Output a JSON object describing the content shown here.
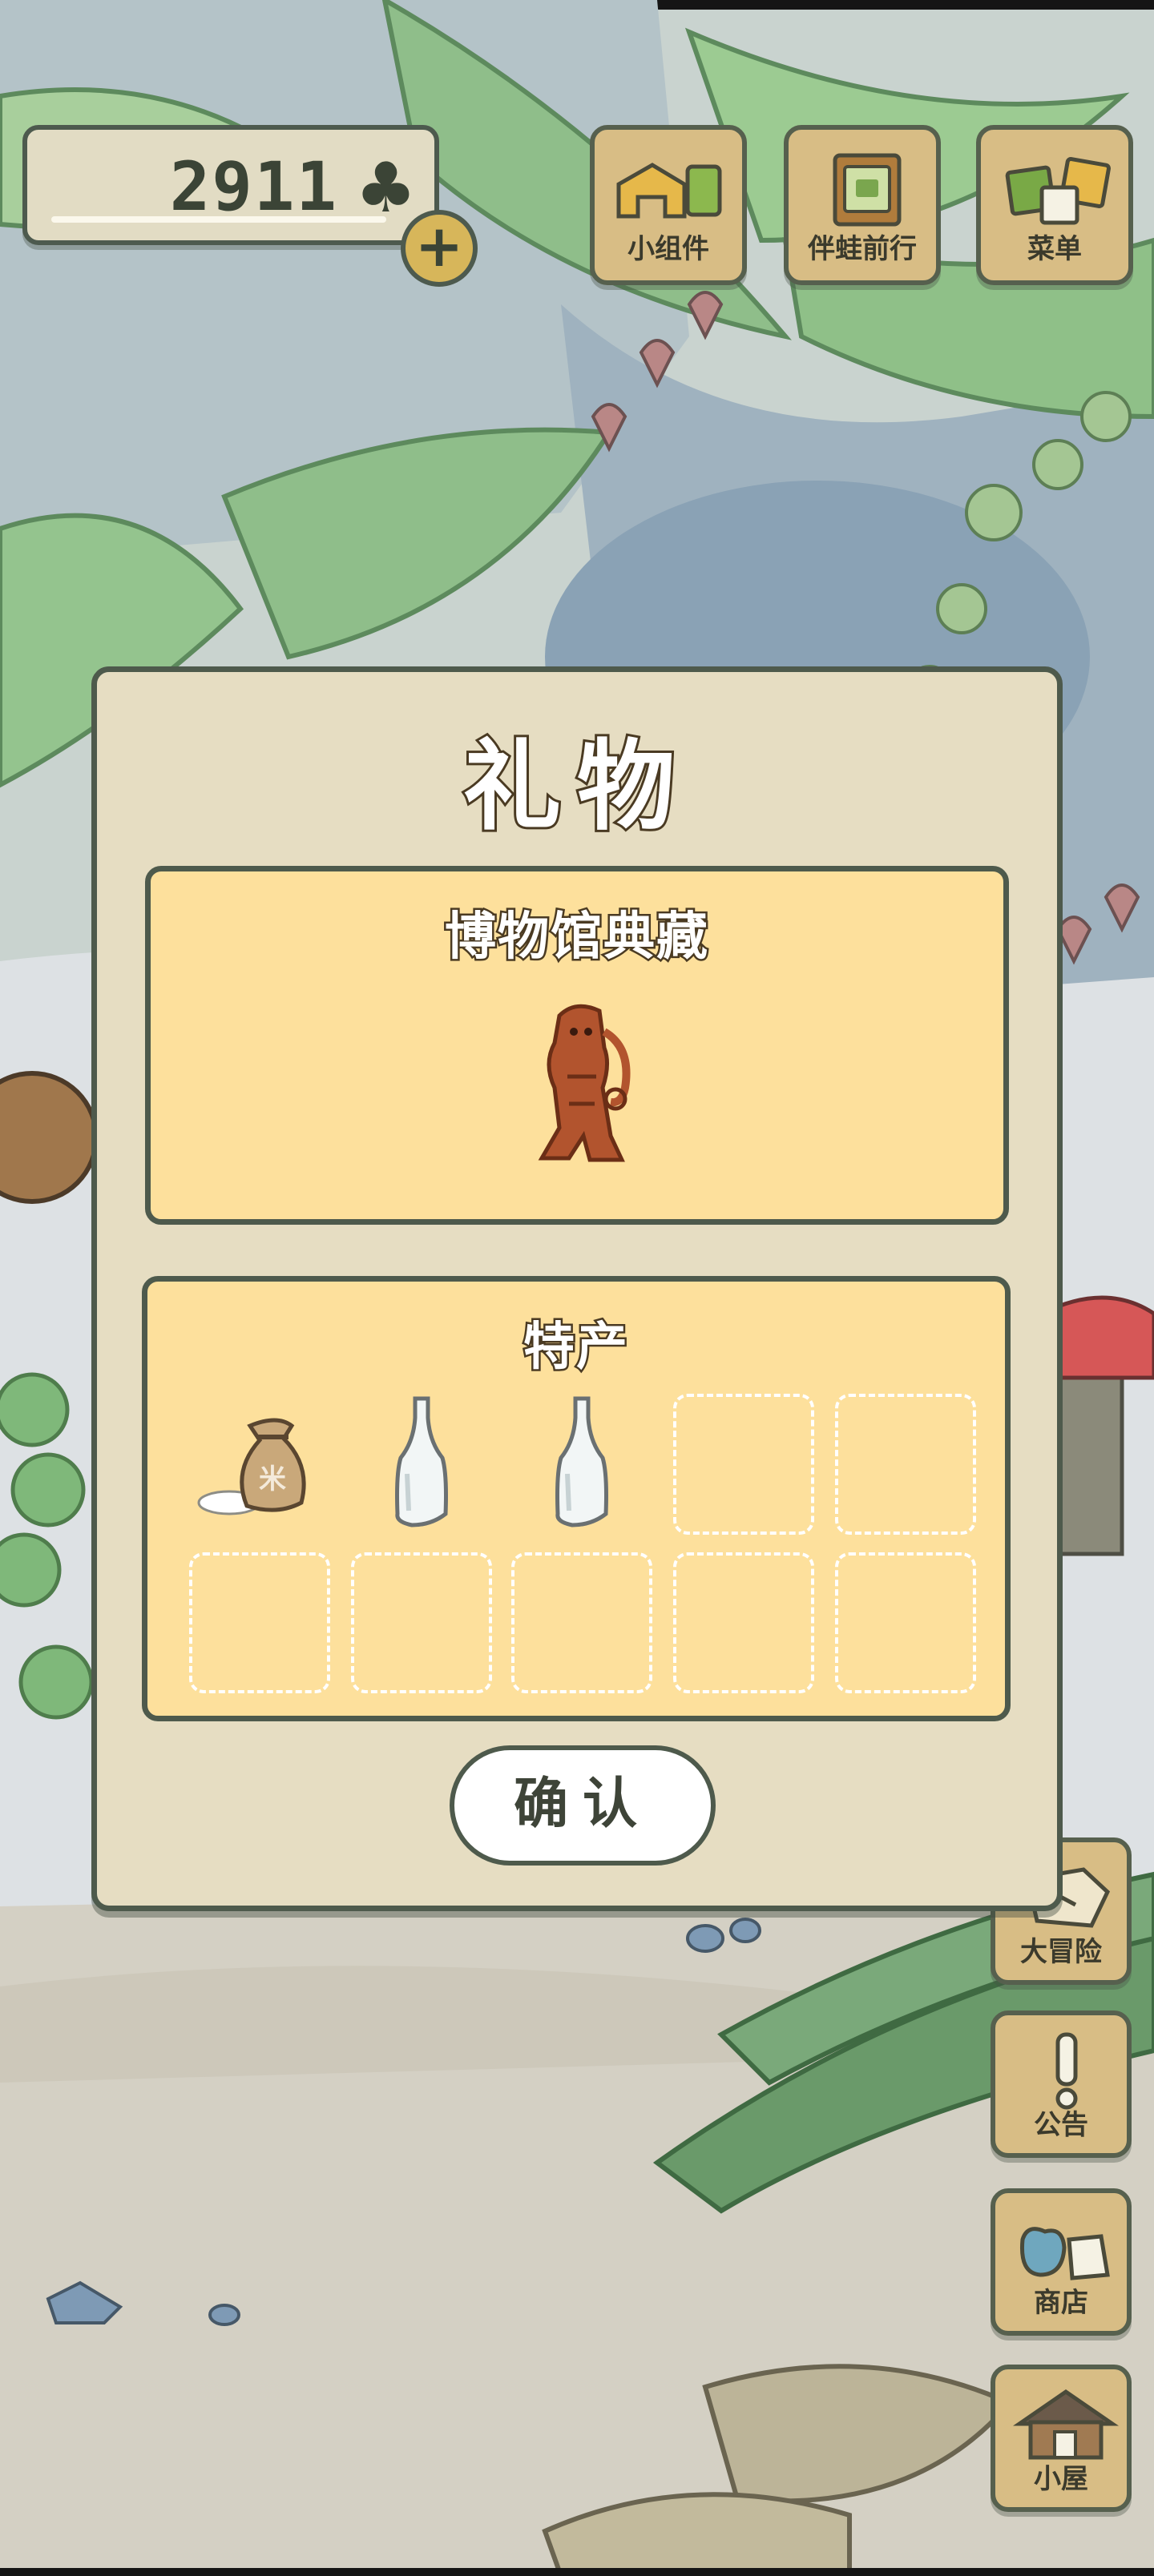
{
  "currency": {
    "amount": "2911",
    "icon": "clover-icon"
  },
  "top_buttons": [
    {
      "label": "小组件",
      "icon": "widget-icon"
    },
    {
      "label": "伴蛙前行",
      "icon": "companion-book-icon"
    },
    {
      "label": "菜单",
      "icon": "menu-cards-icon"
    }
  ],
  "dialog": {
    "title": "礼物",
    "museum": {
      "heading": "博物馆典藏",
      "item_icon": "clay-figurine-icon"
    },
    "specialty": {
      "heading": "特产",
      "items": [
        {
          "icon": "rice-bag-icon",
          "bag_text": "米"
        },
        {
          "icon": "glass-bottle-icon"
        },
        {
          "icon": "glass-bottle-icon"
        }
      ]
    },
    "confirm_label": "确认"
  },
  "side_buttons": [
    {
      "label": "大冒险",
      "icon": "adventure-icon"
    },
    {
      "label": "公告",
      "icon": "notice-icon"
    },
    {
      "label": "商店",
      "icon": "shop-icon"
    },
    {
      "label": "小屋",
      "icon": "house-icon"
    }
  ]
}
